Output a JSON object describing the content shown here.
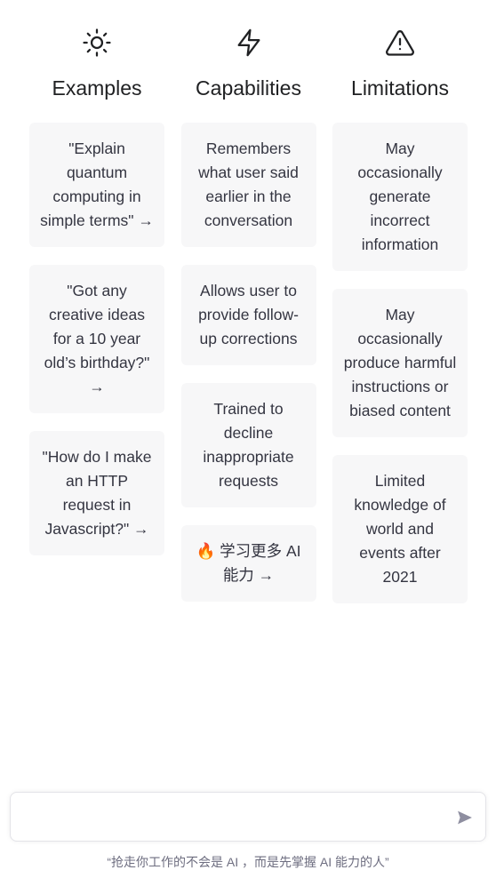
{
  "columns": [
    {
      "icon": "sun-icon",
      "title": "Examples",
      "cards": [
        "\"Explain quantum computing in simple terms\" →",
        "\"Got any creative ideas for a 10 year old’s birthday?\" →",
        "\"How do I make an HTTP request in Javascript?\" →"
      ]
    },
    {
      "icon": "lightning-icon",
      "title": "Capabilities",
      "cards": [
        "Remembers what user said earlier in the conversation",
        "Allows user to provide follow-up corrections",
        "Trained to decline inappropriate requests",
        "🔥 学习更多 AI 能力 →"
      ]
    },
    {
      "icon": "warning-icon",
      "title": "Limitations",
      "cards": [
        "May occasionally generate incorrect information",
        "May occasionally produce harmful instructions or biased content",
        "Limited knowledge of world and events after 2021"
      ]
    }
  ],
  "input": {
    "value": "",
    "placeholder": ""
  },
  "footer": {
    "text": "“抢走你工作的不会是 AI ，而是先掌握 AI 能力的人”"
  }
}
